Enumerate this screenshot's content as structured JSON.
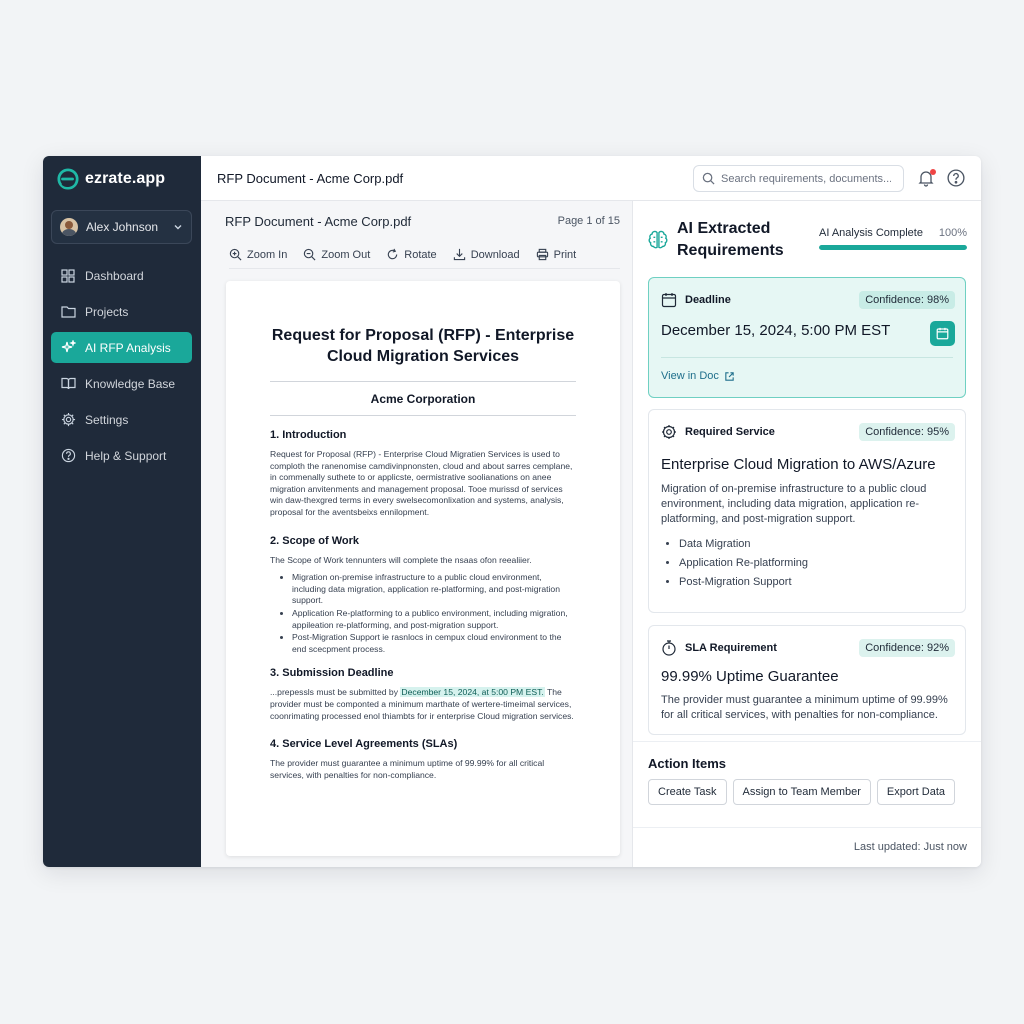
{
  "brand": {
    "name": "ezrate.app"
  },
  "user": {
    "name": "Alex Johnson"
  },
  "nav": [
    {
      "label": "Dashboard",
      "icon": "grid-icon"
    },
    {
      "label": "Projects",
      "icon": "folder-icon"
    },
    {
      "label": "AI RFP Analysis",
      "icon": "sparkle-icon",
      "active": true
    },
    {
      "label": "Knowledge Base",
      "icon": "book-icon"
    },
    {
      "label": "Settings",
      "icon": "gear-icon"
    },
    {
      "label": "Help & Support",
      "icon": "help-circle-icon"
    }
  ],
  "topbar": {
    "title": "RFP Document - Acme Corp.pdf",
    "search_placeholder": "Search requirements, documents..."
  },
  "doc": {
    "name": "RFP Document - Acme Corp.pdf",
    "page": "Page 1 of 15",
    "tools": [
      "Zoom In",
      "Zoom Out",
      "Rotate",
      "Download",
      "Print"
    ],
    "title": "Request for Proposal (RFP) - Enterprise Cloud Migration Services",
    "org": "Acme Corporation",
    "s1_title": "1. Introduction",
    "s1_text": "Request for Proposal (RFP) - Enterprise Cloud Migratien Services is used to comploth the ranenomise camdivinpnonsten, cloud and about sarres cemplane, in commenally suthete to or applicste, oermistrative soolianations on anee migration anvitenments and management proposal. Tooe murissd of services win daw-thexgred terms in every swelsecomonlixation and systems, analysis, proposal for the aventsbeixs ennilopment.",
    "s2_title": "2. Scope of Work",
    "s2_intro": "The Scope of Work tennunters will complete the nsaas ofon reealiier.",
    "s2_bullets": [
      "Migration on-premise infrastructure to a public cloud environment, including data migration, application re-platforming, and post-migration support.",
      "Application Re-platforming to a publico environment, including migration, appileation re-platforming, and post-migration support.",
      "Post-Migration Support ie rasnlocs in cempux cloud environment to the end scecpment process."
    ],
    "s3_title": "3. Submission Deadline",
    "s3_pre": "...prepessls must be submitted by ",
    "s3_highlight": "December 15, 2024, at 5:00 PM EST.",
    "s3_post": " The provider must be componted a minimum marthate of wertere-timeimal services, coonrimating processed enol thiambts for ir enterprise Cloud migration services.",
    "s4_title": "4. Service Level Agreements (SLAs)",
    "s4_text": "The provider must guarantee a minimum uptime of 99.99% for all critical services, with penalties for non-compliance."
  },
  "panel": {
    "title": "AI Extracted Requirements",
    "analysis_label": "AI Analysis Complete",
    "analysis_pct_label": "100%",
    "analysis_progress": 1.0,
    "deadline": {
      "label": "Deadline",
      "confidence": "Confidence: 98%",
      "value": "December 15, 2024, 5:00 PM EST",
      "link": "View in Doc"
    },
    "service": {
      "label": "Required Service",
      "confidence": "Confidence: 95%",
      "value": "Enterprise Cloud Migration to AWS/Azure",
      "desc": "Migration of on-premise infrastructure to a public cloud environment, including data migration, application re-platforming, and post-migration support.",
      "bullets": [
        "Data Migration",
        "Application Re-platforming",
        "Post-Migration Support"
      ]
    },
    "sla": {
      "label": "SLA Requirement",
      "confidence": "Confidence: 92%",
      "value": "99.99% Uptime Guarantee",
      "desc": "The provider must guarantee a minimum uptime of 99.99% for all critical services, with penalties for non-compliance."
    },
    "actions_title": "Action Items",
    "actions": [
      "Create Task",
      "Assign to Team Member",
      "Export Data"
    ],
    "updated": "Last updated: Just now"
  },
  "colors": {
    "accent": "#1aa89a",
    "sidebar": "#1f2a3a",
    "alert": "#ef4444"
  }
}
